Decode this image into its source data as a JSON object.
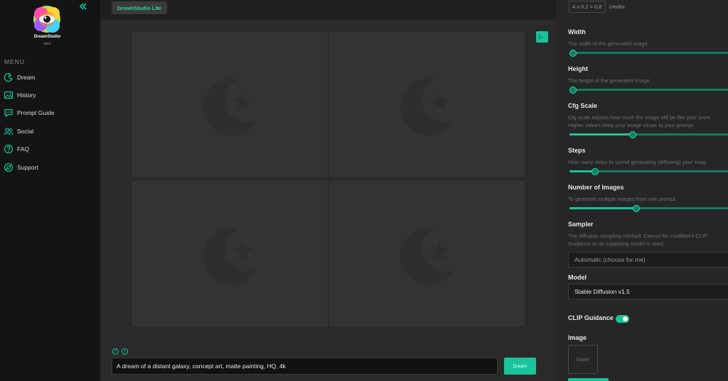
{
  "brand": {
    "name": "DreamStudio",
    "subtitle": "beta"
  },
  "menu": {
    "title": "MENU",
    "items": [
      {
        "label": "Dream",
        "icon": "dream-icon"
      },
      {
        "label": "History",
        "icon": "history-icon"
      },
      {
        "label": "Prompt Guide",
        "icon": "prompt-guide-icon"
      },
      {
        "label": "Social",
        "icon": "social-icon"
      },
      {
        "label": "FAQ",
        "icon": "faq-icon"
      },
      {
        "label": "Support",
        "icon": "support-icon"
      }
    ]
  },
  "topbar": {
    "app_tab": "DreamStudio Lite"
  },
  "canvas": {
    "expand_label": "|←",
    "placeholder_icon": "moon-star-icon",
    "tiles": 4
  },
  "prompt": {
    "text": "A dream of a distant galaxy, concept art, matte painting, HQ, 4k",
    "button_label": "Dream",
    "help_icons": [
      "?",
      "i"
    ]
  },
  "panel": {
    "credits_formula": "4 x 0.2 = 0.8",
    "credits_label": "credits",
    "width": {
      "label": "Width",
      "desc": "The width of the generated image.",
      "value": 0.0
    },
    "height": {
      "label": "Height",
      "desc": "The height of the generated image.",
      "value": 0.0
    },
    "cfg": {
      "label": "Cfg Scale",
      "desc1": "Cfg scale adjusts how much the image will be like your prom",
      "desc2": "Higher values keep your image closer to your prompt.",
      "value": 0.4
    },
    "steps": {
      "label": "Steps",
      "desc": "How many steps to spend generating (diffusing) your imag",
      "value": 0.16
    },
    "images": {
      "label": "Number of Images",
      "desc": "To generate multiple images from one prompt.",
      "value": 0.42
    },
    "sampler": {
      "label": "Sampler",
      "desc1": "The diffusion sampling method. Cannot be modified if CLIP",
      "desc2": "Guidance or an inpainting model is used.",
      "value": "Automatic (choose for me)"
    },
    "model": {
      "label": "Model",
      "value": "Stable Diffusion v1.5"
    },
    "clip": {
      "label": "CLIP Guidance",
      "enabled": true
    },
    "image": {
      "label": "Image",
      "value": "None"
    }
  },
  "colors": {
    "accent": "#19c49a",
    "sidebar": "#141414",
    "canvas": "#2a2a2a",
    "panel": "#262626"
  }
}
